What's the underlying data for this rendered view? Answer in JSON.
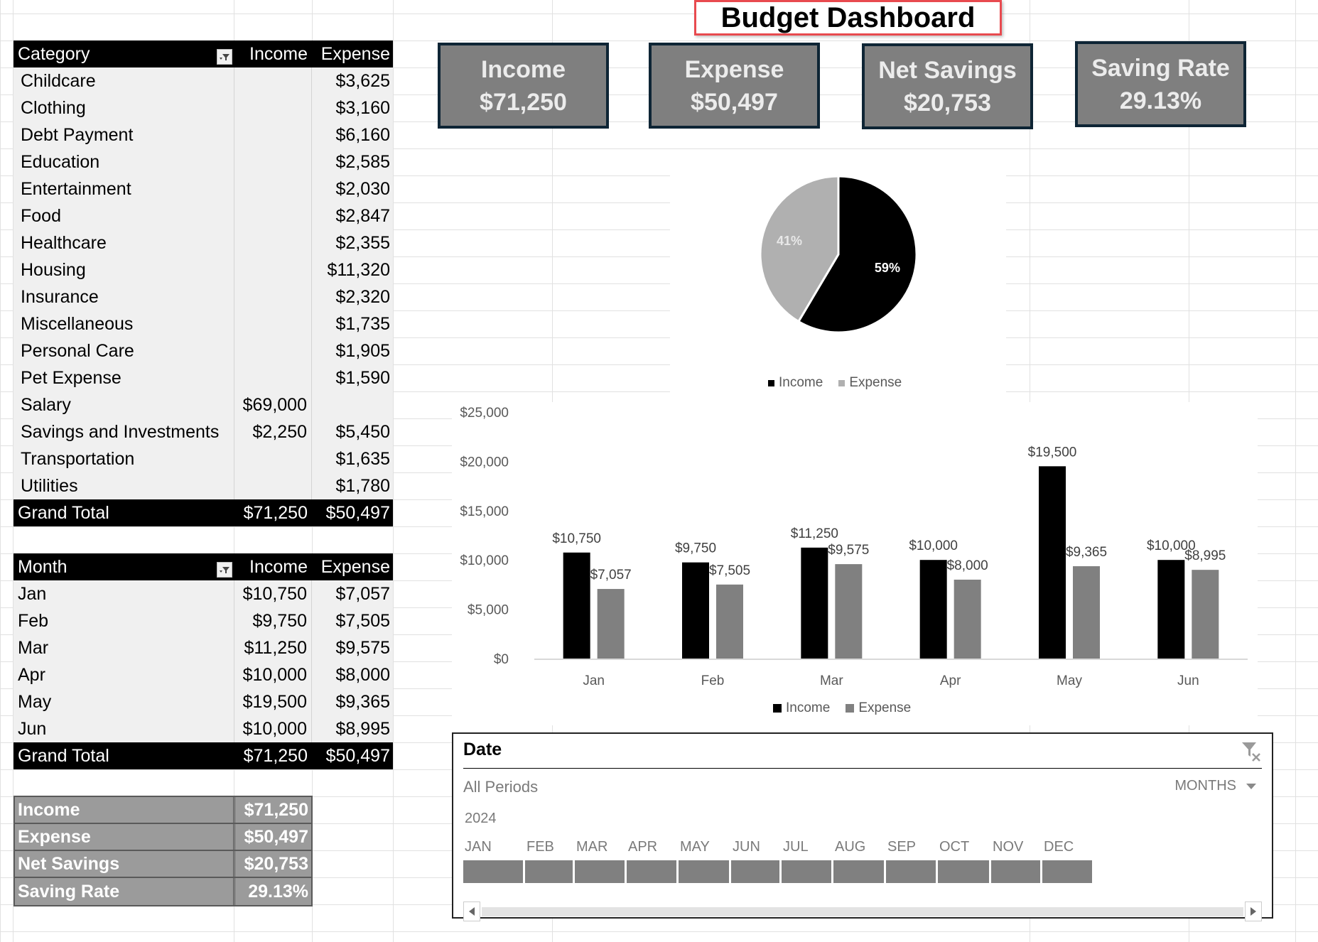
{
  "title": "Budget Dashboard",
  "kpis": [
    {
      "label": "Income",
      "value": "$71,250"
    },
    {
      "label": "Expense",
      "value": "$50,497"
    },
    {
      "label": "Net Savings",
      "value": "$20,753"
    },
    {
      "label": "Saving Rate",
      "value": "29.13%"
    }
  ],
  "category_table": {
    "headers": [
      "Category",
      "Income",
      "Expense"
    ],
    "rows": [
      {
        "category": "Childcare",
        "income": "",
        "expense": "$3,625"
      },
      {
        "category": "Clothing",
        "income": "",
        "expense": "$3,160"
      },
      {
        "category": "Debt Payment",
        "income": "",
        "expense": "$6,160"
      },
      {
        "category": "Education",
        "income": "",
        "expense": "$2,585"
      },
      {
        "category": "Entertainment",
        "income": "",
        "expense": "$2,030"
      },
      {
        "category": "Food",
        "income": "",
        "expense": "$2,847"
      },
      {
        "category": "Healthcare",
        "income": "",
        "expense": "$2,355"
      },
      {
        "category": "Housing",
        "income": "",
        "expense": "$11,320"
      },
      {
        "category": "Insurance",
        "income": "",
        "expense": "$2,320"
      },
      {
        "category": "Miscellaneous",
        "income": "",
        "expense": "$1,735"
      },
      {
        "category": "Personal Care",
        "income": "",
        "expense": "$1,905"
      },
      {
        "category": "Pet Expense",
        "income": "",
        "expense": "$1,590"
      },
      {
        "category": "Salary",
        "income": "$69,000",
        "expense": ""
      },
      {
        "category": "Savings and Investments",
        "income": "$2,250",
        "expense": "$5,450"
      },
      {
        "category": "Transportation",
        "income": "",
        "expense": "$1,635"
      },
      {
        "category": "Utilities",
        "income": "",
        "expense": "$1,780"
      }
    ],
    "total": {
      "label": "Grand Total",
      "income": "$71,250",
      "expense": "$50,497"
    }
  },
  "month_table": {
    "headers": [
      "Month",
      "Income",
      "Expense"
    ],
    "rows": [
      {
        "month": "Jan",
        "income": "$10,750",
        "expense": "$7,057"
      },
      {
        "month": "Feb",
        "income": "$9,750",
        "expense": "$7,505"
      },
      {
        "month": "Mar",
        "income": "$11,250",
        "expense": "$9,575"
      },
      {
        "month": "Apr",
        "income": "$10,000",
        "expense": "$8,000"
      },
      {
        "month": "May",
        "income": "$19,500",
        "expense": "$9,365"
      },
      {
        "month": "Jun",
        "income": "$10,000",
        "expense": "$8,995"
      }
    ],
    "total": {
      "label": "Grand Total",
      "income": "$71,250",
      "expense": "$50,497"
    }
  },
  "summary_table": [
    {
      "label": "Income",
      "value": "$71,250"
    },
    {
      "label": "Expense",
      "value": "$50,497"
    },
    {
      "label": "Net Savings",
      "value": "$20,753"
    },
    {
      "label": "Saving Rate",
      "value": "29.13%"
    }
  ],
  "colors": {
    "income": "#000000",
    "expense_pie": "#b0b0b0",
    "expense_bar": "#808080",
    "kpi_bg": "#7f7f7f",
    "kpi_border": "#0e2535",
    "title_border": "#e84a4f"
  },
  "chart_data": [
    {
      "type": "pie",
      "title": "",
      "categories": [
        "Income",
        "Expense"
      ],
      "values": [
        71250,
        50497
      ],
      "labels": [
        "59%",
        "41%"
      ],
      "legend": [
        "Income",
        "Expense"
      ],
      "legend_position": "bottom"
    },
    {
      "type": "bar",
      "title": "",
      "categories": [
        "Jan",
        "Feb",
        "Mar",
        "Apr",
        "May",
        "Jun"
      ],
      "series": [
        {
          "name": "Income",
          "values": [
            10750,
            9750,
            11250,
            10000,
            19500,
            10000
          ],
          "labels": [
            "$10,750",
            "$9,750",
            "$11,250",
            "$10,000",
            "$19,500",
            "$10,000"
          ]
        },
        {
          "name": "Expense",
          "values": [
            7057,
            7505,
            9575,
            8000,
            9365,
            8995
          ],
          "labels": [
            "$7,057",
            "$7,505",
            "$9,575",
            "$8,000",
            "$9,365",
            "$8,995"
          ]
        }
      ],
      "yticks": [
        "$0",
        "$5,000",
        "$10,000",
        "$15,000",
        "$20,000",
        "$25,000"
      ],
      "ylim": [
        0,
        25000
      ],
      "xlabel": "",
      "ylabel": "",
      "grid": false,
      "legend": [
        "Income",
        "Expense"
      ],
      "legend_position": "bottom"
    }
  ],
  "timeline": {
    "title": "Date",
    "period": "All Periods",
    "level": "MONTHS",
    "year": "2024",
    "months": [
      "JAN",
      "FEB",
      "MAR",
      "APR",
      "MAY",
      "JUN",
      "JUL",
      "AUG",
      "SEP",
      "OCT",
      "NOV",
      "DEC"
    ]
  }
}
